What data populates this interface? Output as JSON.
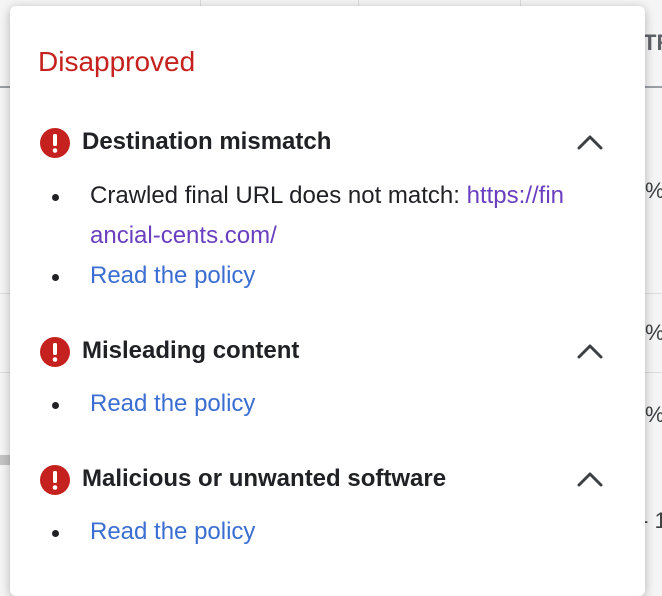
{
  "background": {
    "header_fragment": "TR",
    "row_fragments": [
      "%",
      "%",
      "%",
      "- 1"
    ]
  },
  "popup": {
    "status": "Disapproved",
    "status_color": "#c5221f",
    "issues": [
      {
        "title": "Destination mismatch",
        "icon": "error-icon",
        "expand_icon": "chevron-up-icon",
        "detail_prefix": "Crawled final URL does not match: ",
        "detail_url_line1": "https://fin",
        "detail_url_line2": "ancial-cents.com/",
        "policy_link": "Read the policy"
      },
      {
        "title": "Misleading content",
        "icon": "error-icon",
        "expand_icon": "chevron-up-icon",
        "policy_link": "Read the policy"
      },
      {
        "title": "Malicious or unwanted software",
        "icon": "error-icon",
        "expand_icon": "chevron-up-icon",
        "policy_link": "Read the policy"
      }
    ]
  }
}
